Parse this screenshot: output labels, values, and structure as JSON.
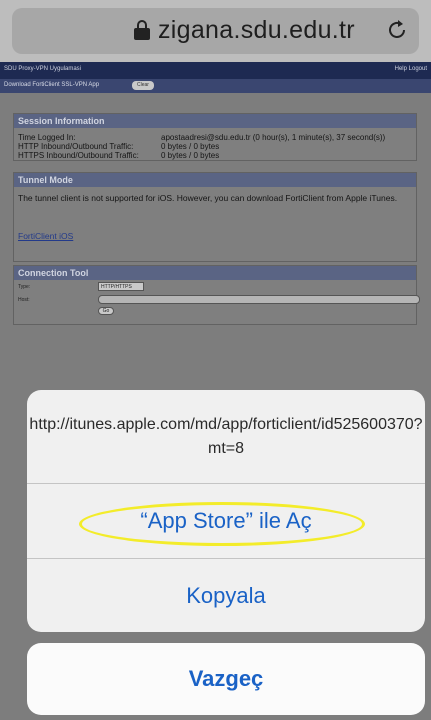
{
  "browser": {
    "url": "zigana.sdu.edu.tr",
    "lock_icon": "lock-icon",
    "reload_icon": "reload-icon"
  },
  "webpage": {
    "topbar_title": "SDU Proxy-VPN Uygulamasi",
    "topbar_right": "Help  Logout",
    "subbar_label": "Download FortiClient SSL-VPN App",
    "subbar_button": "Clear",
    "session": {
      "heading": "Session Information",
      "rows": [
        {
          "label": "Time Logged In:",
          "value": "apostaadresi@sdu.edu.tr (0 hour(s), 1 minute(s), 37 second(s))"
        },
        {
          "label": "HTTP Inbound/Outbound Traffic:",
          "value": "0 bytes / 0 bytes"
        },
        {
          "label": "HTTPS Inbound/Outbound Traffic:",
          "value": "0 bytes / 0 bytes"
        }
      ]
    },
    "tunnel": {
      "heading": "Tunnel Mode",
      "text": "The tunnel client is not supported for iOS. However, you can download FortiClient from Apple iTunes.",
      "link": "FortiClient iOS"
    },
    "connection": {
      "heading": "Connection Tool",
      "type_label": "Type:",
      "type_value": "HTTP/HTTPS",
      "host_label": "Host:",
      "go_button": "Go"
    }
  },
  "action_sheet": {
    "message": "http://itunes.apple.com/md/app/forticlient/id525600370?mt=8",
    "open_label": "“App Store” ile Aç",
    "copy_label": "Kopyala",
    "cancel_label": "Vazgeç",
    "highlight_color": "#f3ec2a",
    "accent_color": "#1a62c6"
  }
}
